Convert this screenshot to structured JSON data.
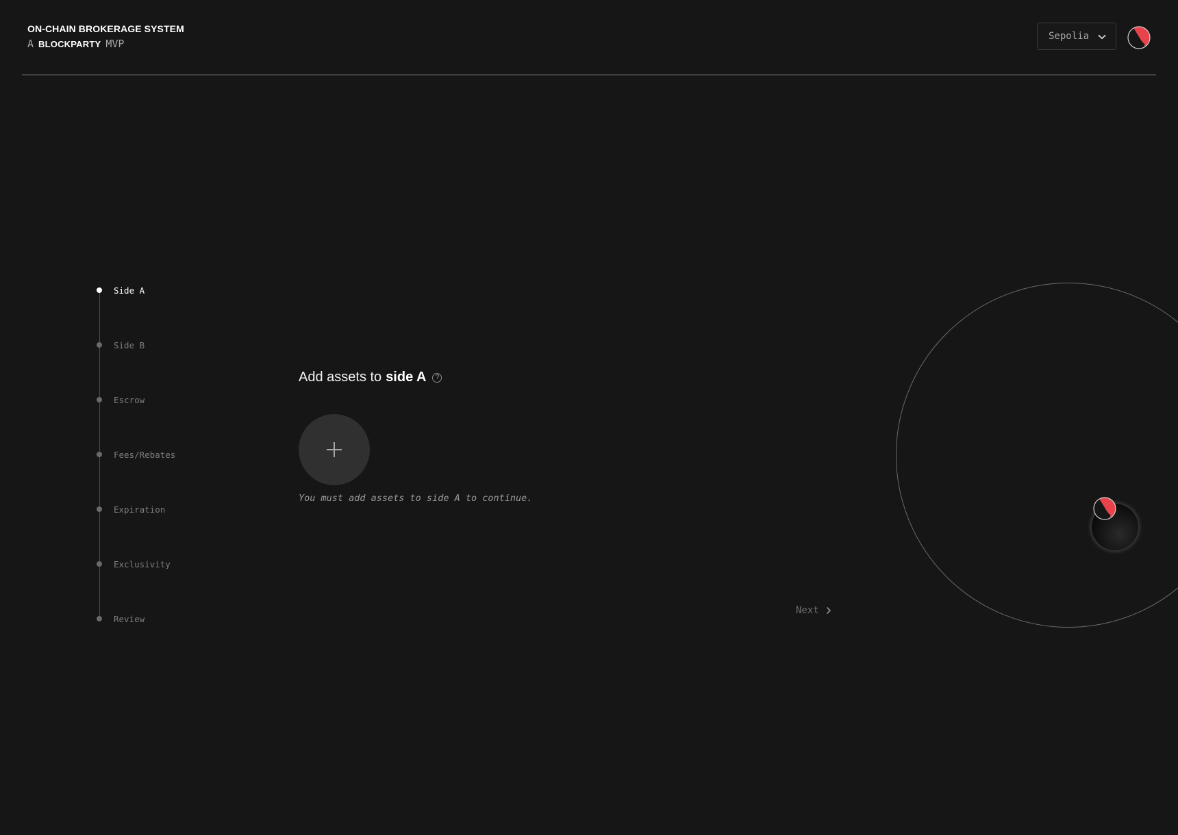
{
  "header": {
    "title": "ON-CHAIN BROKERAGE SYSTEM",
    "subtitle_prefix": "A",
    "subtitle_brand": "BLOCKPARTY",
    "subtitle_suffix": "MVP",
    "network": {
      "selected": "Sepolia",
      "icon": "chevron-down-icon"
    },
    "account_icon": "blockparty-logo-icon"
  },
  "stepper": {
    "steps": [
      {
        "label": "Side A",
        "active": true
      },
      {
        "label": "Side B",
        "active": false
      },
      {
        "label": "Escrow",
        "active": false
      },
      {
        "label": "Fees/Rebates",
        "active": false
      },
      {
        "label": "Expiration",
        "active": false
      },
      {
        "label": "Exclusivity",
        "active": false
      },
      {
        "label": "Review",
        "active": false
      }
    ]
  },
  "main": {
    "title_prefix": "Add assets to",
    "title_emphasis": "side A",
    "help_symbol": "?",
    "add_button_icon": "plus-icon",
    "hint": "You must add assets to side A to continue.",
    "next_label": "Next",
    "next_icon": "chevron-right-icon"
  },
  "colors": {
    "background": "#161616",
    "accent": "#e8434b",
    "text_primary": "#ffffff",
    "text_muted": "#7d7d7d"
  }
}
